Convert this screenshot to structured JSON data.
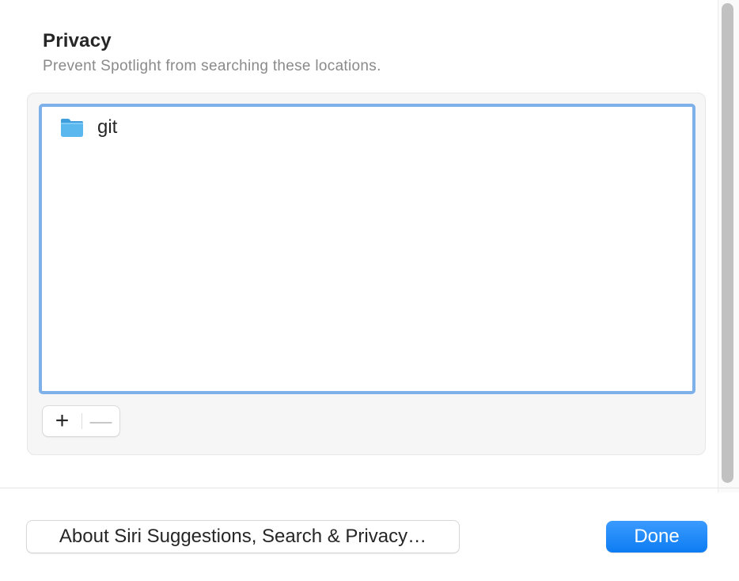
{
  "privacy": {
    "title": "Privacy",
    "subtitle": "Prevent Spotlight from searching these locations."
  },
  "list": {
    "items": [
      {
        "label": "git",
        "icon": "folder-icon"
      }
    ]
  },
  "controls": {
    "add_label": "+",
    "remove_label": "—"
  },
  "footer": {
    "about_label": "About Siri Suggestions, Search & Privacy…",
    "done_label": "Done"
  },
  "colors": {
    "accent": "#0d7cf2",
    "focus_ring": "#7eb0ea",
    "folder": "#5ab8ef"
  }
}
